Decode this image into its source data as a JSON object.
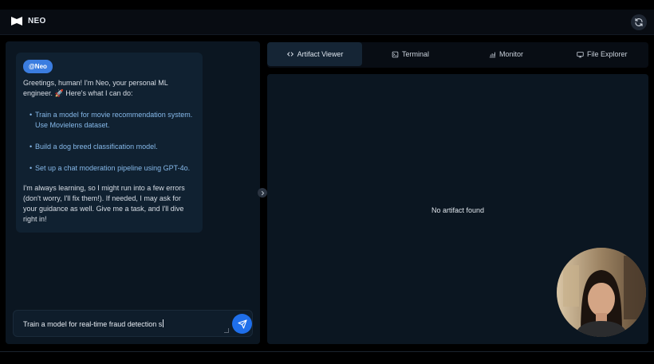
{
  "app": {
    "name": "NEO"
  },
  "header": {
    "refresh_icon": "refresh-icon"
  },
  "chat": {
    "tag": "@Neo",
    "greeting": "Greetings, human! I'm Neo, your personal ML engineer. 🚀 Here's what I can do:",
    "suggestions": [
      "Train a model for movie recommendation system. Use Movielens dataset.",
      "Build a dog breed classification model.",
      "Set up a chat moderation pipeline using GPT-4o."
    ],
    "outro": "I'm always learning, so I might run into a few errors (don't worry, I'll fix them!). If needed, I may ask for your guidance as well. Give me a task, and I'll dive right in!",
    "input_value": "Train a model for real-time fraud detection s"
  },
  "tabs": [
    {
      "label": "Artifact Viewer",
      "icon": "code-icon",
      "active": true
    },
    {
      "label": "Terminal",
      "icon": "terminal-icon",
      "active": false
    },
    {
      "label": "Monitor",
      "icon": "chart-icon",
      "active": false
    },
    {
      "label": "File Explorer",
      "icon": "monitor-icon",
      "active": false
    }
  ],
  "viewer": {
    "empty_message": "No artifact found"
  },
  "colors": {
    "background": "#000000",
    "panel": "#0b1621",
    "bubble": "#102131",
    "accent": "#1f6feb",
    "tag": "#3b7de0",
    "suggestion_text": "#86b9ea"
  }
}
